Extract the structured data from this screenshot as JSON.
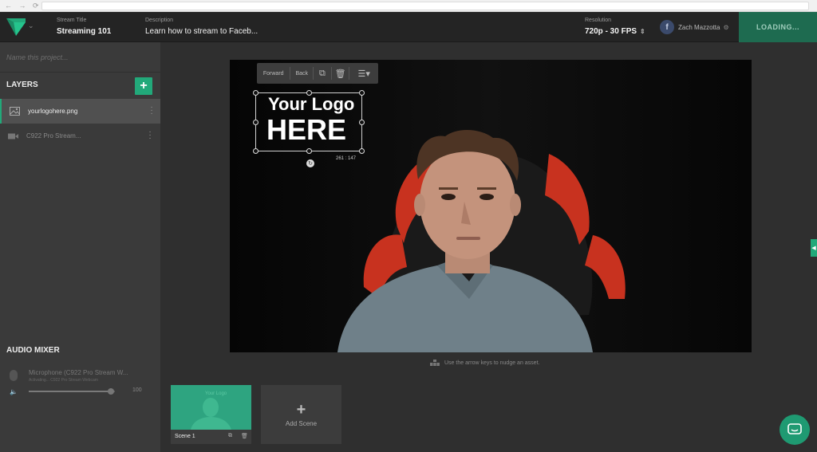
{
  "browser": {
    "nav_glyphs": "← → ⟳"
  },
  "header": {
    "stream_title_label": "Stream Title",
    "stream_title": "Streaming 101",
    "description_label": "Description",
    "description": "Learn how to stream to Faceb...",
    "resolution_label": "Resolution",
    "resolution": "720p - 30 FPS",
    "account_name": "Zach Mazzotta",
    "loading_label": "LOADING..."
  },
  "sidebar": {
    "project_placeholder": "Name this project...",
    "layers_title": "LAYERS",
    "add_layer_glyph": "+",
    "layers": [
      {
        "name": "yourlogohere.png",
        "icon": "image-icon"
      },
      {
        "name": "C922 Pro Stream...",
        "icon": "camera-icon"
      }
    ],
    "audio_title": "AUDIO MIXER",
    "audio": {
      "source_name": "Microphone (C922 Pro Stream W...",
      "source_status": "Activating...  C922 Pro Stream Webcam",
      "volume": 100,
      "volume_fraction": 0.95
    }
  },
  "canvas": {
    "toolbar": {
      "forward": "Forward",
      "back": "Back"
    },
    "logo_line1": "Your Logo",
    "logo_line2": "HERE",
    "dimensions": "261 : 147",
    "hint": "Use the arrow keys to nudge an asset."
  },
  "scenes": {
    "items": [
      {
        "label": "Scene 1"
      }
    ],
    "add_label": "Add Scene",
    "add_glyph": "+"
  },
  "colors": {
    "accent": "#22a97a",
    "loading_bg": "#1e6b50",
    "header_bg": "#242424",
    "sidebar_bg": "#3a3a3a",
    "canvas_bg": "#2f2f2f",
    "chair_red": "#c8321f"
  }
}
